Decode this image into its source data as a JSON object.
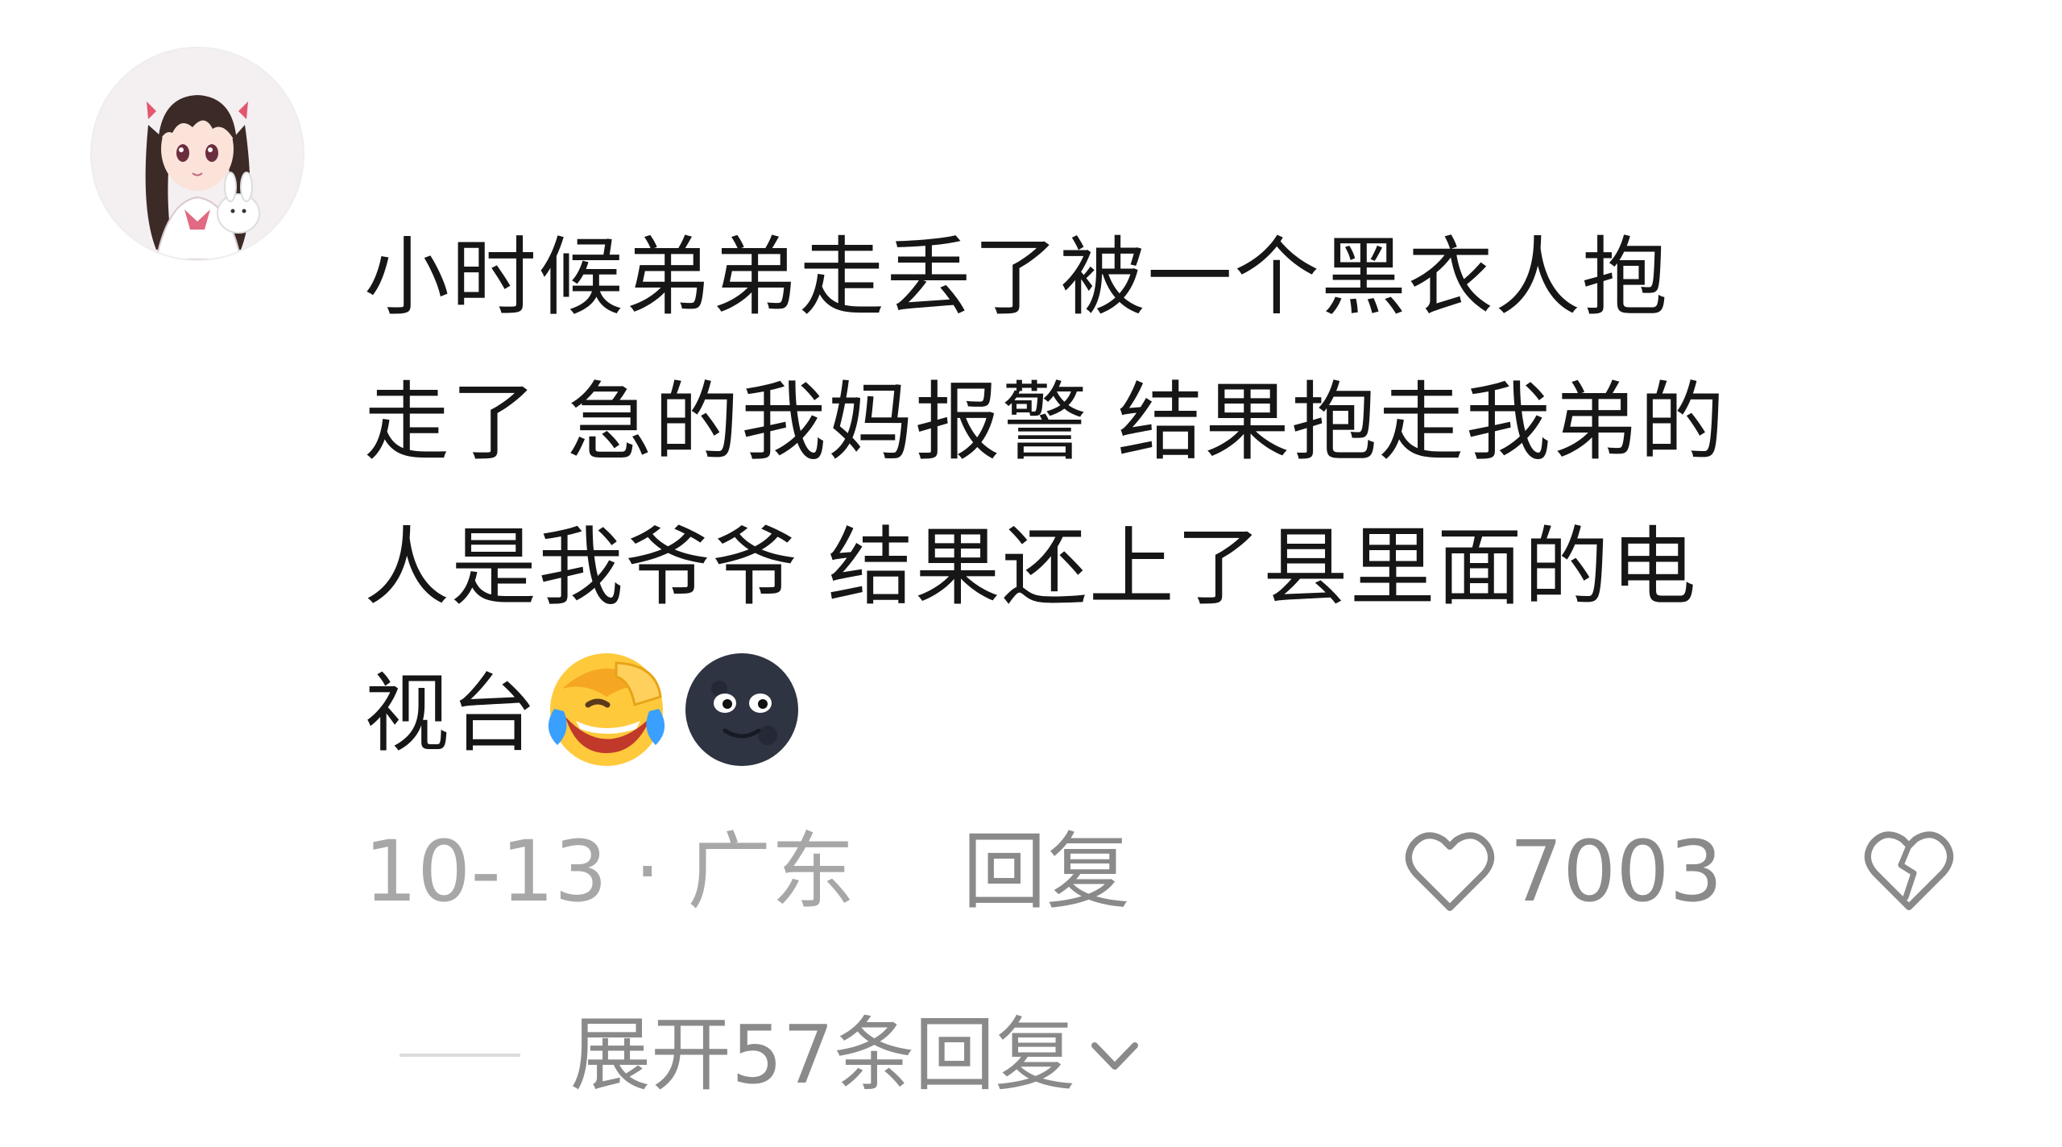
{
  "comment": {
    "avatar_icon": "anime-girl-avatar",
    "text_lines": [
      "小时候弟弟走丢了被一个黑衣人抱",
      "走了 急的我妈报警 结果抱走我弟的",
      "人是我爷爷 结果还上了县里面的电",
      "视台"
    ],
    "emojis": [
      "laughing-crying-emoji",
      "dark-moon-face-emoji"
    ],
    "date": "10-13",
    "separator": "·",
    "location": "广东",
    "reply_label": "回复",
    "like_icon": "heart-outline-icon",
    "like_count": "7003",
    "dislike_icon": "broken-heart-icon",
    "expand_label": "展开57条回复",
    "expand_icon": "chevron-down-icon"
  },
  "colors": {
    "text": "#161616",
    "meta": "#a7a7a7",
    "action": "#8a8a8a",
    "background": "#ffffff"
  }
}
